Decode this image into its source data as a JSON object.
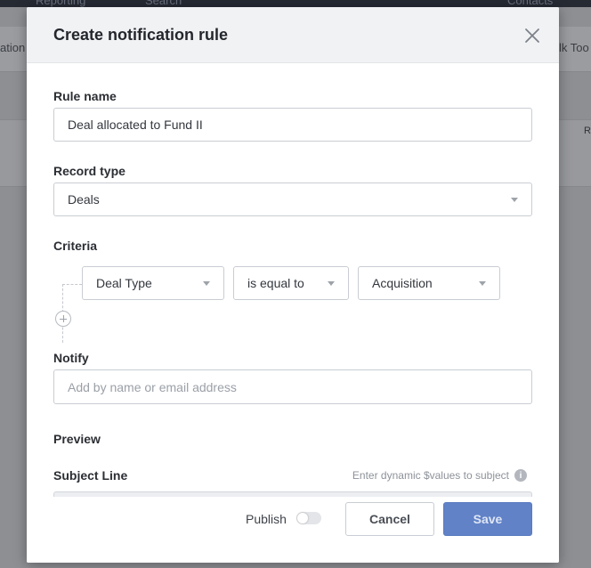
{
  "background": {
    "topbar": {
      "item1": "Reporting",
      "item2": "Search",
      "item3": "Contacts"
    },
    "subbar": {
      "left": "ation",
      "right": "lk Too"
    },
    "band": {
      "col": "R"
    }
  },
  "modal": {
    "title": "Create notification rule",
    "rule_name": {
      "label": "Rule name",
      "value": "Deal allocated to Fund II"
    },
    "record_type": {
      "label": "Record type",
      "value": "Deals"
    },
    "criteria": {
      "label": "Criteria",
      "field": "Deal Type",
      "operator": "is equal to",
      "value": "Acquisition"
    },
    "notify": {
      "label": "Notify",
      "placeholder": "Add by name or email address"
    },
    "preview": {
      "label": "Preview",
      "subject_label": "Subject Line",
      "subject_hint": "Enter dynamic $values to subject",
      "info_glyph": "i"
    },
    "footer": {
      "publish_label": "Publish",
      "publish_on": false,
      "cancel_label": "Cancel",
      "save_label": "Save"
    }
  },
  "colors": {
    "accent": "#6182c7",
    "header_bg": "#f1f2f4"
  }
}
